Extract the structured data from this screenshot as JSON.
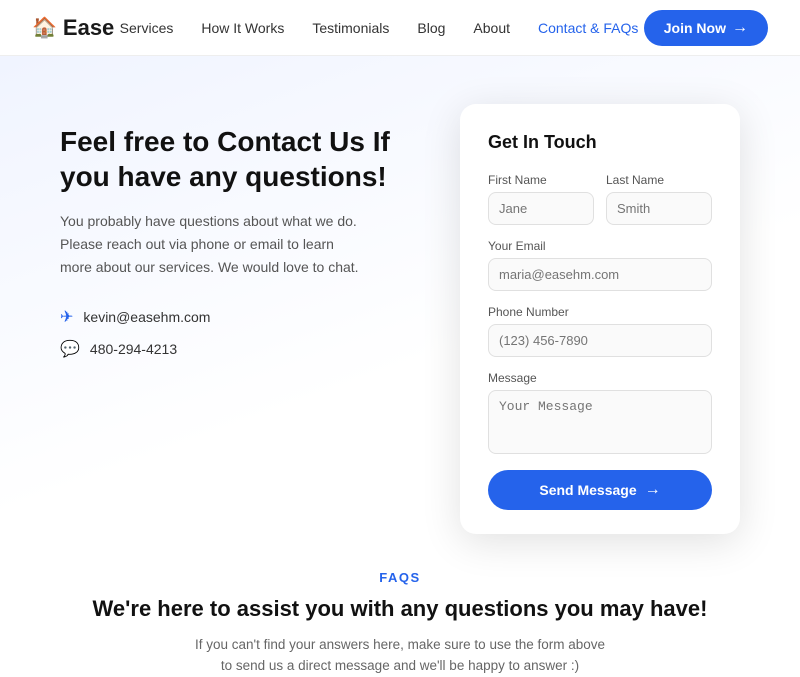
{
  "navbar": {
    "logo_icon": "🏠",
    "logo_text": "Ease",
    "links": [
      {
        "label": "Services",
        "active": false
      },
      {
        "label": "How It Works",
        "active": false
      },
      {
        "label": "Testimonials",
        "active": false
      },
      {
        "label": "Blog",
        "active": false
      },
      {
        "label": "About",
        "active": false
      },
      {
        "label": "Contact & FAQs",
        "active": true
      }
    ],
    "join_button": "Join Now"
  },
  "left": {
    "title": "Feel free to Contact Us If you have any questions!",
    "description": "You probably have questions about what we do. Please reach out via phone or email to learn more about our services. We would love to chat.",
    "email": "kevin@easehm.com",
    "phone": "480-294-4213"
  },
  "form": {
    "title": "Get In Touch",
    "first_name_label": "First Name",
    "first_name_placeholder": "Jane",
    "last_name_label": "Last Name",
    "last_name_placeholder": "Smith",
    "email_label": "Your Email",
    "email_placeholder": "maria@easehm.com",
    "phone_label": "Phone Number",
    "phone_placeholder": "(123) 456-7890",
    "message_label": "Message",
    "message_placeholder": "Your Message",
    "send_button": "Send Message"
  },
  "faqs": {
    "label": "FAQS",
    "title": "We're here to assist you with any questions you may have!",
    "description": "If you can't find your answers here, make sure to use the form above to send us a direct message and we'll be happy to answer :)"
  }
}
